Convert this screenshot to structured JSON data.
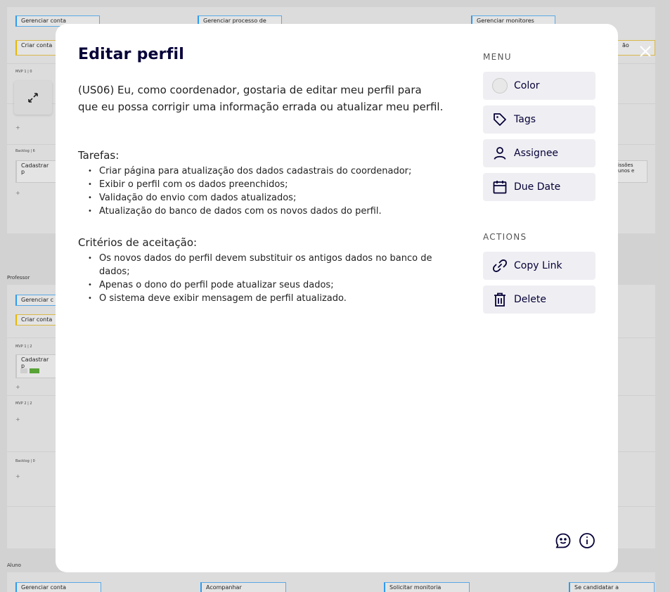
{
  "board": {
    "lanes": {
      "professor": "Professor",
      "aluno": "Aluno"
    },
    "cards_top": [
      "Gerenciar conta",
      "Gerenciar processo de",
      "Gerenciar monitores",
      "Criar conta",
      "ão",
      "Cadastrar p",
      "issões\nunos e"
    ],
    "cards_prof": [
      "Gerenciar c",
      "Criar conta",
      "Cadastrar p"
    ],
    "cards_bottom": [
      "Gerenciar conta",
      "Acompanhar",
      "Solicitar monitoria",
      "Se candidatar a"
    ],
    "mini_labels": [
      "MVP 1 | 0",
      "Backlog | 6",
      "MVP 1 | 2",
      "MVP 2 | 2",
      "Backlog | 0"
    ]
  },
  "modal": {
    "title": "Editar perfil",
    "description": "(US06) Eu, como coordenador, gostaria de editar meu perfil para que eu possa corrigir uma informação errada ou atualizar meu perfil.",
    "tasks_heading": "Tarefas:",
    "tasks": [
      "Criar página para atualização dos dados cadastrais do coordenador;",
      "Exibir o perfil com os dados preenchidos;",
      "Validação do envio com dados atualizados;",
      "Atualização do banco de dados com os novos dados do perfil."
    ],
    "criteria_heading": "Critérios de aceitação:",
    "criteria": [
      "Os novos dados do perfil devem substituir os antigos dados no banco de dados;",
      "Apenas o dono do perfil pode atualizar seus dados;",
      "O sistema deve exibir mensagem de perfil atualizado."
    ],
    "menu_heading": "MENU",
    "menu": {
      "color": "Color",
      "tags": "Tags",
      "assignee": "Assignee",
      "due_date": "Due Date"
    },
    "actions_heading": "ACTIONS",
    "actions": {
      "copy_link": "Copy Link",
      "delete": "Delete"
    },
    "footer_icons": [
      "feedback-smile-icon",
      "info-icon"
    ]
  },
  "close_icon": "close-icon",
  "colors": {
    "overlay": "#bdbdbd",
    "modal_bg": "#ffffff",
    "button_bg": "#efeff3",
    "text_dark": "#050038",
    "card_blue": "#2d9bf0",
    "card_yellow": "#e6b800",
    "green": "#58a236"
  }
}
